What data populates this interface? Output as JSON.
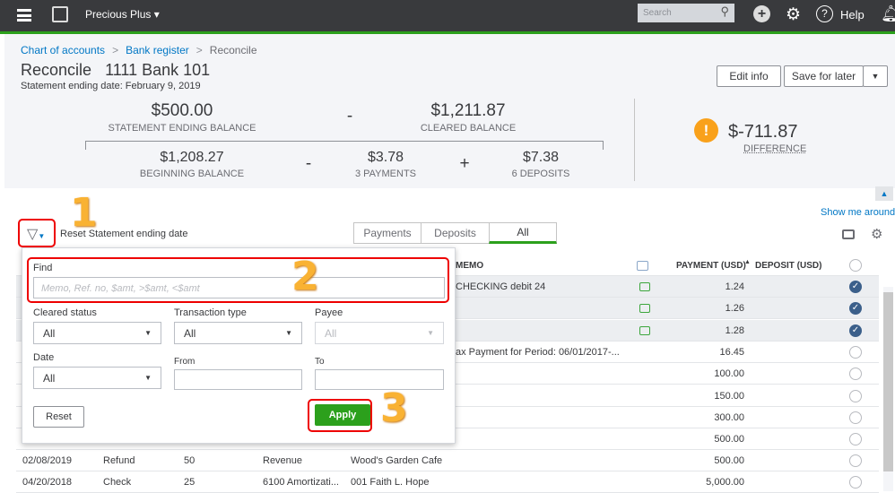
{
  "topbar": {
    "company": "Precious Plus",
    "search_placeholder": "Search",
    "help": "Help"
  },
  "breadcrumb": [
    "Chart of accounts",
    "Bank register",
    "Reconcile"
  ],
  "breadcrumb_sep": ">",
  "title": "Reconcile",
  "account": "1111 Bank 101",
  "statement_date": "Statement ending date: February 9, 2019",
  "buttons": {
    "edit_info": "Edit info",
    "save_for_later": "Save for later"
  },
  "summary": {
    "statement_ending_balance": "$500.00",
    "statement_ending_balance_label": "STATEMENT ENDING BALANCE",
    "cleared_balance": "$1,211.87",
    "cleared_balance_label": "CLEARED BALANCE",
    "beginning_balance": "$1,208.27",
    "beginning_balance_label": "BEGINNING BALANCE",
    "payments": "$3.78",
    "payments_label": "3 PAYMENTS",
    "deposits": "$7.38",
    "deposits_label": "6 DEPOSITS",
    "minus": "-",
    "plus": "+",
    "difference": "$-711.87",
    "difference_label": "DIFFERENCE"
  },
  "show_me_around": "Show me around",
  "reset_date": "Reset Statement ending date",
  "tabs": [
    "Payments",
    "Deposits",
    "All"
  ],
  "active_tab": "All",
  "columns": {
    "memo": "MEMO",
    "payment": "PAYMENT (USD)",
    "deposit": "DEPOSIT (USD)"
  },
  "rows": [
    {
      "memo": "CHECKING debit 24",
      "payment": "1.24",
      "cleared": true,
      "matched": true
    },
    {
      "memo": "",
      "payment": "1.26",
      "cleared": true,
      "matched": true
    },
    {
      "memo": "",
      "payment": "1.28",
      "cleared": true,
      "matched": true
    },
    {
      "memo": "ax Payment for Period: 06/01/2017-...",
      "payment": "16.45",
      "cleared": false
    },
    {
      "memo": "",
      "payment": "100.00",
      "cleared": false
    },
    {
      "memo": "",
      "payment": "150.00",
      "cleared": false
    },
    {
      "memo": "",
      "payment": "300.00",
      "cleared": false
    },
    {
      "memo": "",
      "payment": "500.00",
      "cleared": false
    },
    {
      "date": "02/08/2019",
      "type": "Refund",
      "ref": "50",
      "account": "Revenue",
      "payee": "Wood's Garden Cafe",
      "payment": "500.00",
      "cleared": false
    },
    {
      "date": "04/20/2018",
      "type": "Check",
      "ref": "25",
      "account": "6100 Amortizati...",
      "payee": "001 Faith L. Hope",
      "payment": "5,000.00",
      "cleared": false
    }
  ],
  "filter": {
    "find_label": "Find",
    "find_placeholder": "Memo, Ref. no, $amt, >$amt, <$amt",
    "cleared_status_label": "Cleared status",
    "cleared_status": "All",
    "transaction_type_label": "Transaction type",
    "transaction_type": "All",
    "payee_label": "Payee",
    "payee": "All",
    "date_label": "Date",
    "date": "All",
    "from_label": "From",
    "to_label": "To",
    "reset": "Reset",
    "apply": "Apply"
  },
  "annotations": [
    "1",
    "2",
    "3"
  ],
  "colors": {
    "green": "#2ca01c",
    "topbar": "#393a3d",
    "link": "#0077c5",
    "warning": "#f9a11b",
    "red": "#e00000"
  }
}
